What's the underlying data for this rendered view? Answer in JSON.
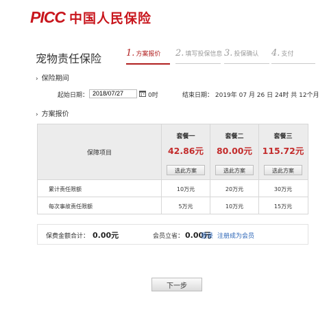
{
  "brand": {
    "mark": "PICC",
    "name": "中国人民保险",
    "color": "#c8161d"
  },
  "page_title": "宠物责任保险",
  "steps": [
    {
      "num": "1.",
      "label": "方案报价",
      "active": true
    },
    {
      "num": "2.",
      "label": "填写投保信息",
      "active": false
    },
    {
      "num": "3.",
      "label": "投保确认",
      "active": false
    },
    {
      "num": "4.",
      "label": "支付",
      "active": false
    }
  ],
  "period": {
    "section_title": "保险期间",
    "start_label": "起始日期：",
    "start_value": "2018/07/27",
    "start_hour": "0时",
    "end_text": "结束日期： 2019年 07 月 26 日 24时 共 12个月"
  },
  "quote": {
    "section_title": "方案报价",
    "guarantee_label": "保障项目",
    "packages": [
      {
        "name": "套餐一",
        "price": "42.86元",
        "button": "选此方案"
      },
      {
        "name": "套餐二",
        "price": "80.00元",
        "button": "选此方案"
      },
      {
        "name": "套餐三",
        "price": "115.72元",
        "button": "选此方案"
      }
    ],
    "rows": [
      {
        "label": "累计责任限额",
        "values": [
          "10万元",
          "20万元",
          "30万元"
        ]
      },
      {
        "label": "每次事故责任限额",
        "values": [
          "5万元",
          "10万元",
          "15万元"
        ]
      }
    ],
    "price_color": "#c32b2b"
  },
  "summary": {
    "total_label": "保费金额合计：",
    "total_value": "0.00元",
    "saving_label": "会员立省：",
    "saving_value": "0.00元",
    "login_link": "登录",
    "register_link": "注册成为会员"
  },
  "next_button": "下一步"
}
